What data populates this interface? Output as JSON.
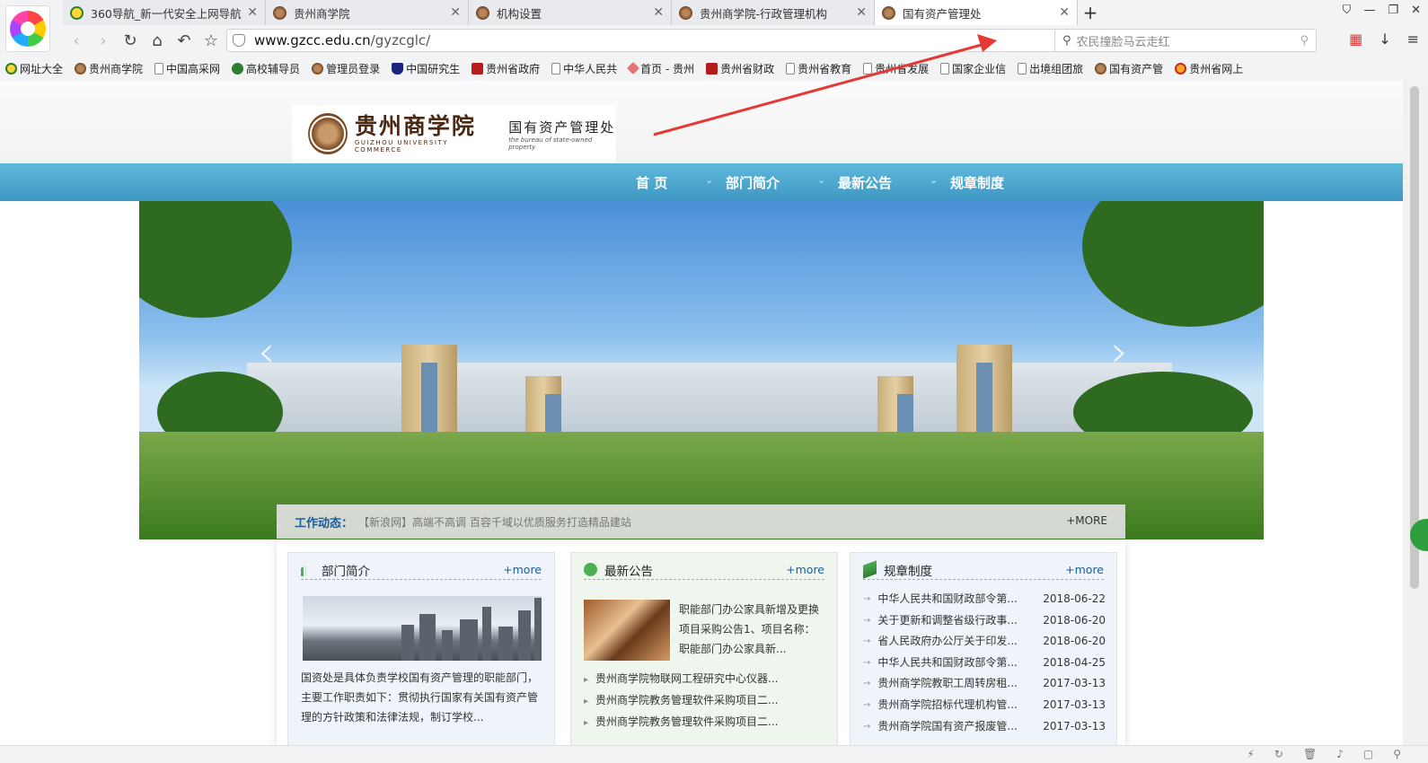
{
  "tabs": [
    {
      "label": "360导航_新一代安全上网导航",
      "icon": "360-icon"
    },
    {
      "label": "贵州商学院",
      "icon": "gzcc-seal-icon"
    },
    {
      "label": "机构设置",
      "icon": "gzcc-seal-icon"
    },
    {
      "label": "贵州商学院-行政管理机构",
      "icon": "gzcc-seal-icon"
    },
    {
      "label": "国有资产管理处",
      "icon": "gzcc-seal-icon",
      "active": true
    }
  ],
  "address": {
    "domain": "www.gzcc.edu.cn",
    "path": "/gyzcglc/"
  },
  "search": {
    "placeholder": "农民撞脸马云走红"
  },
  "bookmarks": [
    {
      "label": "网址大全",
      "icon": "360-icon"
    },
    {
      "label": "贵州商学院",
      "icon": "gzcc-seal-icon"
    },
    {
      "label": "中国高采网",
      "icon": "doc-icon"
    },
    {
      "label": "高校辅导员",
      "icon": "green-circle-icon"
    },
    {
      "label": "管理员登录",
      "icon": "gzcc-seal-icon"
    },
    {
      "label": "中国研究生",
      "icon": "grad-cap-icon"
    },
    {
      "label": "贵州省政府",
      "icon": "red-square-icon"
    },
    {
      "label": "中华人民共",
      "icon": "doc-icon"
    },
    {
      "label": "首页 - 贵州",
      "icon": "pink-diamond-icon"
    },
    {
      "label": "贵州省财政",
      "icon": "red-square-icon"
    },
    {
      "label": "贵州省教育",
      "icon": "doc-icon"
    },
    {
      "label": "贵州省发展",
      "icon": "doc-icon"
    },
    {
      "label": "国家企业信",
      "icon": "doc-icon"
    },
    {
      "label": "出境组团旅",
      "icon": "doc-icon"
    },
    {
      "label": "国有资产管",
      "icon": "gzcc-seal-icon"
    },
    {
      "label": "贵州省网上",
      "icon": "emblem-icon"
    }
  ],
  "site": {
    "name_cn": "贵州商学院",
    "name_en": "GUIZHOU UNIVERSITY COMMERCE",
    "dept_cn": "国有资产管理处",
    "dept_en": "the bureau of state-owned property"
  },
  "menu": [
    "首 页",
    "部门简介",
    "最新公告",
    "规章制度"
  ],
  "news_ticker": {
    "label": "工作动态：",
    "text": "【新浪网】高端不高调 百容千域以优质服务打造精品建站",
    "more": "+MORE"
  },
  "panels": {
    "intro": {
      "title": "部门简介",
      "more": "+more",
      "desc": "国资处是具体负责学校国有资产管理的职能部门，主要工作职责如下：贯彻执行国家有关国有资产管理的方针政策和法律法规，制订学校..."
    },
    "notice": {
      "title": "最新公告",
      "more": "+more",
      "summary": "职能部门办公家具新增及更换项目采购公告1、项目名称：职能部门办公家具新...",
      "items": [
        "贵州商学院物联网工程研究中心仪器...",
        "贵州商学院教务管理软件采购项目二...",
        "贵州商学院教务管理软件采购项目二..."
      ]
    },
    "rules": {
      "title": "规章制度",
      "more": "+more",
      "items": [
        {
          "title": "中华人民共和国财政部令第...",
          "date": "2018-06-22"
        },
        {
          "title": "关于更新和调整省级行政事...",
          "date": "2018-06-20"
        },
        {
          "title": "省人民政府办公厅关于印发...",
          "date": "2018-06-20"
        },
        {
          "title": "中华人民共和国财政部令第...",
          "date": "2018-04-25"
        },
        {
          "title": "贵州商学院教职工周转房租...",
          "date": "2017-03-13"
        },
        {
          "title": "贵州商学院招标代理机构管...",
          "date": "2017-03-13"
        },
        {
          "title": "贵州商学院国有资产报废管...",
          "date": "2017-03-13"
        }
      ]
    }
  },
  "colors": {
    "menu_blue": "#4aa8d0",
    "link_blue": "#1d5c9b",
    "annotation_red": "#e53935"
  }
}
